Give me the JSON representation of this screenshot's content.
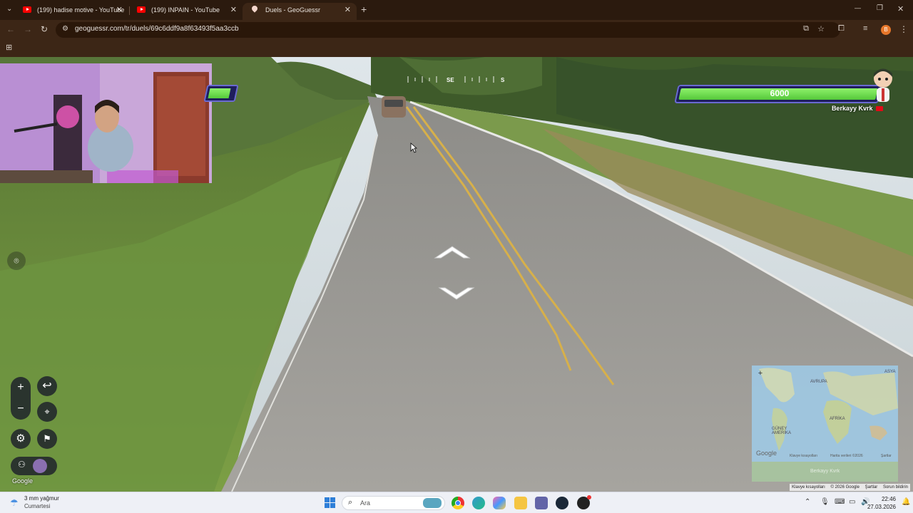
{
  "browser": {
    "tabs": [
      {
        "title": "(199) hadise motive - YouTube",
        "active": false
      },
      {
        "title": "(199) INPAIN - YouTube",
        "active": false
      },
      {
        "title": "Duels - GeoGuessr",
        "active": true
      }
    ],
    "new_tab": "+",
    "url": "geoguessr.com/tr/duels/69c6ddf9a8f63493f5aa3ccb",
    "profile_initial": "B",
    "window_controls": {
      "minimize": "—",
      "maximize": "❐",
      "close": "✕"
    }
  },
  "game": {
    "opponent": {
      "name": "Berkayy Kvrk",
      "score": "6000",
      "health_fraction": 1.0
    },
    "player": {
      "health_fraction": 1.0
    },
    "compass": {
      "left_label": "SE",
      "right_label": "S"
    },
    "nav_arrows": {
      "forward": "forward-arrow",
      "back": "back-arrow"
    },
    "controls": {
      "zoom_in": "+",
      "zoom_out": "−",
      "undo_icon": "undo-icon",
      "location_icon": "pin-icon",
      "settings_icon": "gear-icon",
      "flag_icon": "flag-icon",
      "chat_icon": "people-icon",
      "emote_icon": "emote-icon",
      "camera_icon": "camera-icon"
    },
    "google_logo": "Google",
    "minimap": {
      "labels": [
        "AVRUPA",
        "ASYA",
        "AFRİKA",
        "GÜNEY AMERİKA"
      ],
      "watermark": "Google",
      "footer": [
        "Klavye kısayolları",
        "Harita verileri ©2026",
        "Şartlar"
      ],
      "footer_name": "Berkayy Kvrk"
    },
    "attribution": [
      "Klavye kısayolları",
      "© 2026 Google",
      "Şartlar",
      "Sorun bildirin"
    ]
  },
  "taskbar": {
    "weather_temp": "3 mm yağmur",
    "weather_day": "Cumartesi",
    "search_label": "Ara",
    "time": "22:46",
    "date": "27.03.2026"
  },
  "colors": {
    "health_green": "#6edc4a",
    "health_border": "#6a6ad2",
    "browser_bg": "#3c2616"
  }
}
